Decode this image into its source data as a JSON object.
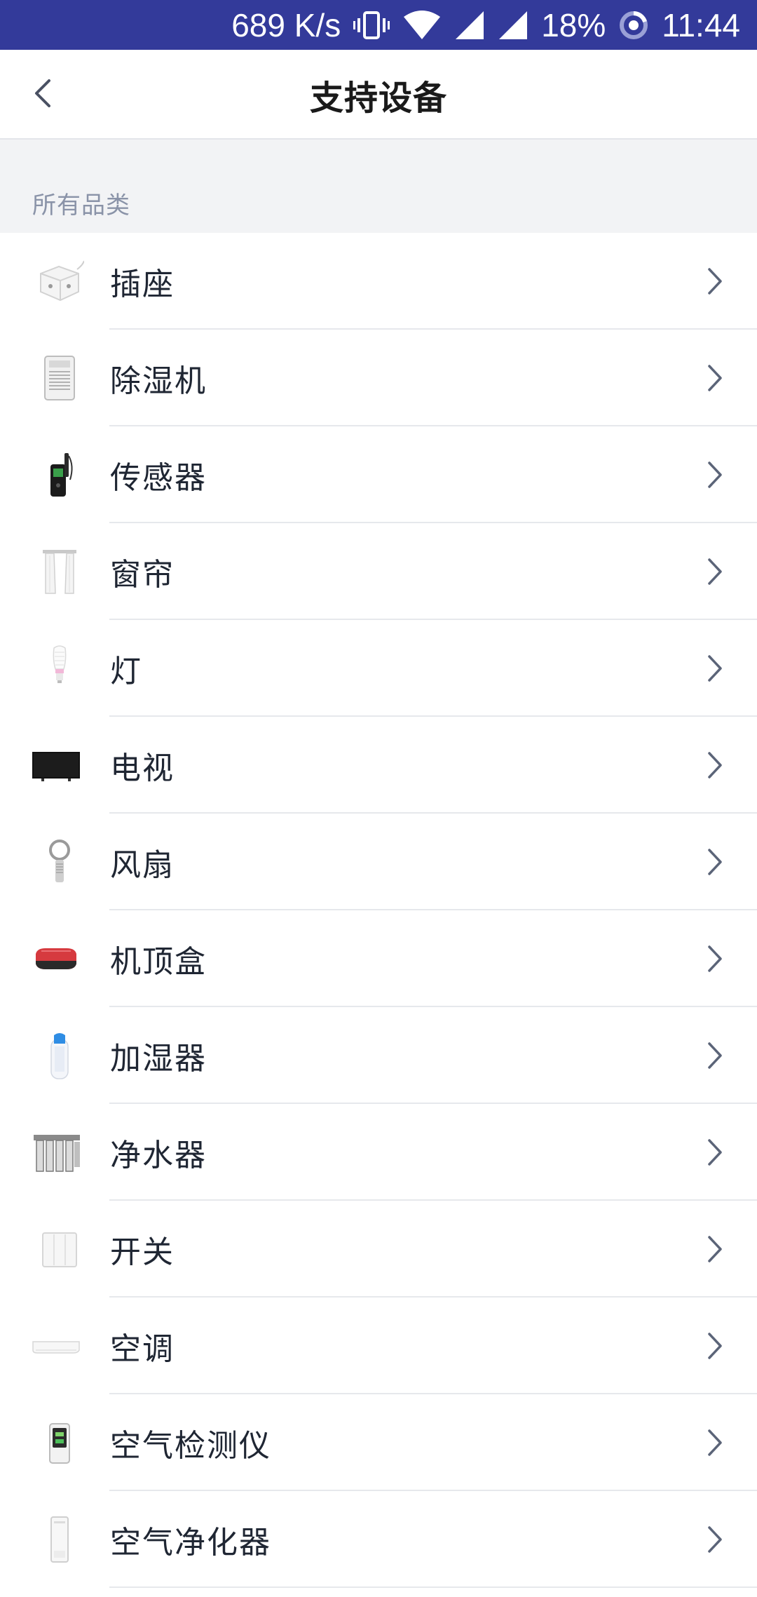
{
  "status_bar": {
    "speed": "689 K/s",
    "battery": "18%",
    "time": "11:44",
    "icons": [
      "vibrate-icon",
      "wifi-icon",
      "signal-icon",
      "signal-icon",
      "battery-ring-icon"
    ]
  },
  "header": {
    "back_icon": "chevron-left-icon",
    "title": "支持设备"
  },
  "section": {
    "label": "所有品类"
  },
  "items": [
    {
      "label": "插座",
      "icon": "socket-icon"
    },
    {
      "label": "除湿机",
      "icon": "dehumidifier-icon"
    },
    {
      "label": "传感器",
      "icon": "sensor-icon"
    },
    {
      "label": "窗帘",
      "icon": "curtain-icon"
    },
    {
      "label": "灯",
      "icon": "bulb-icon"
    },
    {
      "label": "电视",
      "icon": "tv-icon"
    },
    {
      "label": "风扇",
      "icon": "fan-icon"
    },
    {
      "label": "机顶盒",
      "icon": "set-top-box-icon"
    },
    {
      "label": "加湿器",
      "icon": "humidifier-icon"
    },
    {
      "label": "净水器",
      "icon": "water-purifier-icon"
    },
    {
      "label": "开关",
      "icon": "switch-icon"
    },
    {
      "label": "空调",
      "icon": "air-conditioner-icon"
    },
    {
      "label": "空气检测仪",
      "icon": "air-monitor-icon"
    },
    {
      "label": "空气净化器",
      "icon": "air-purifier-icon"
    }
  ],
  "colors": {
    "status_bar": "#333a9a",
    "section_bg": "#f2f3f5",
    "divider": "#e6e8ec",
    "chevron": "#5b6478"
  }
}
